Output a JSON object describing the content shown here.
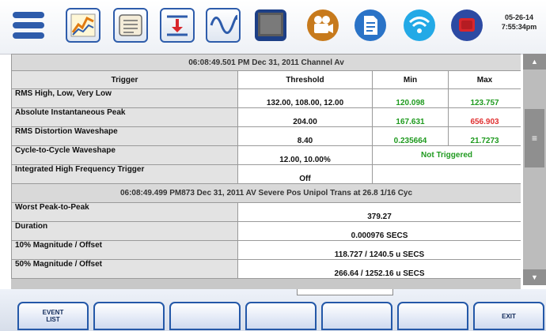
{
  "toolbar": {
    "icons": [
      "menu-icon",
      "trend-chart-icon",
      "scroll-report-icon",
      "download-tray-icon",
      "sine-wave-icon",
      "monitor-screen-icon",
      "video-camera-icon",
      "document-icon",
      "wireless-icon",
      "stop-record-icon"
    ],
    "date": "05-26-14",
    "time": "7:55:34pm"
  },
  "event_header": "06:08:49.501 PM Dec 31, 2011 Channel Av",
  "columns": [
    "Trigger",
    "Threshold",
    "Min",
    "Max"
  ],
  "trigger_rows": [
    {
      "trigger": "RMS High, Low, Very Low",
      "threshold": "132.00, 108.00, 12.00",
      "min": "120.098",
      "max": "123.757"
    },
    {
      "trigger": "Absolute Instantaneous Peak",
      "threshold": "204.00",
      "min": "167.631",
      "max": "656.903"
    },
    {
      "trigger": "RMS Distortion Waveshape",
      "threshold": "8.40",
      "min": "0.235664",
      "max": "21.7273"
    },
    {
      "trigger": "Cycle-to-Cycle Waveshape",
      "threshold": "12.00, 10.00%",
      "status": "Not Triggered"
    },
    {
      "trigger": "Integrated High Frequency Trigger",
      "threshold": "Off"
    }
  ],
  "event2_header": "06:08:49.499 PM873 Dec 31, 2011 AV Severe Pos Unipol Trans at 26.8 1/16 Cyc",
  "detail_rows": [
    {
      "label": "Worst Peak-to-Peak",
      "value": "379.27"
    },
    {
      "label": "Duration",
      "value": "0.000976 SECS"
    },
    {
      "label": "10% Magnitude / Offset",
      "value": "118.727 / 1240.5 u SECS"
    },
    {
      "label": "50% Magnitude / Offset",
      "value": "266.64 / 1252.16 u SECS"
    }
  ],
  "colors": {
    "accent": "#2e5cab",
    "min_value": "#1f9a1f",
    "max_value_alert": "#e03131",
    "panel_bg": "#c8c8c8"
  },
  "soft_keys": {
    "event_list": "EVENT\nLIST",
    "exit": "EXIT"
  },
  "scrollbar": {
    "up": "▲",
    "grip": "≡",
    "down": "▼"
  }
}
